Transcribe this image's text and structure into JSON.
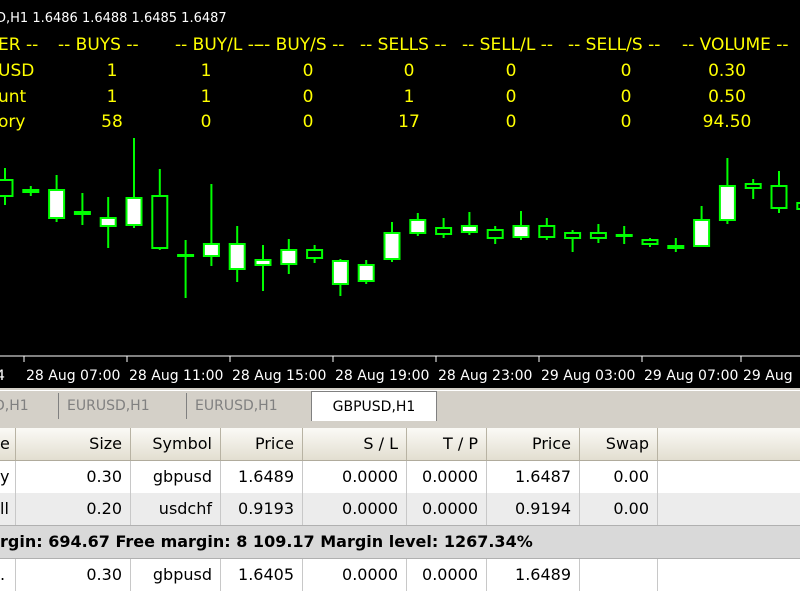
{
  "chart": {
    "info_line": "D,H1  1.6486 1.6488 1.6485 1.6487",
    "panel_headers": [
      "ER --",
      "-- BUYS --",
      "-- BUY/L --",
      "-- BUY/S --",
      "-- SELLS --",
      "-- SELL/L --",
      "-- SELL/S --",
      "-- VOLUME --"
    ],
    "panel_rows": [
      {
        "label": "USD",
        "values": [
          "1",
          "1",
          "0",
          "0",
          "0",
          "0",
          "0.30"
        ]
      },
      {
        "label": "unt",
        "values": [
          "1",
          "1",
          "0",
          "1",
          "0",
          "0",
          "0.50"
        ]
      },
      {
        "label": "ory",
        "values": [
          "58",
          "0",
          "0",
          "17",
          "0",
          "0",
          "94.50"
        ]
      }
    ],
    "time_labels": [
      "4",
      "28 Aug 07:00",
      "28 Aug 11:00",
      "28 Aug 15:00",
      "28 Aug 19:00",
      "28 Aug 23:00",
      "29 Aug 03:00",
      "29 Aug 07:00",
      "29 Aug"
    ],
    "colors": {
      "background": "#000000",
      "up_candle": "#ffffff",
      "wick": "#00ff00",
      "panel_text": "#ffff00"
    }
  },
  "chart_data": {
    "type": "candlestick",
    "note_units": "approximate relative price levels",
    "candles": [
      {
        "o": 180,
        "c": 196,
        "h": 168,
        "l": 205
      },
      {
        "o": 190,
        "c": 192,
        "h": 186,
        "l": 196
      },
      {
        "o": 218,
        "c": 190,
        "h": 175,
        "l": 222
      },
      {
        "o": 212,
        "c": 214,
        "h": 193,
        "l": 225
      },
      {
        "o": 226,
        "c": 218,
        "h": 197,
        "l": 248
      },
      {
        "o": 225,
        "c": 198,
        "h": 138,
        "l": 228
      },
      {
        "o": 196,
        "c": 248,
        "h": 169,
        "l": 250
      },
      {
        "o": 255,
        "c": 255,
        "h": 240,
        "l": 298
      },
      {
        "o": 256,
        "c": 244,
        "h": 184,
        "l": 266
      },
      {
        "o": 269,
        "c": 244,
        "h": 226,
        "l": 282
      },
      {
        "o": 265,
        "c": 260,
        "h": 245,
        "l": 291
      },
      {
        "o": 264,
        "c": 250,
        "h": 239,
        "l": 274
      },
      {
        "o": 250,
        "c": 258,
        "h": 245,
        "l": 263
      },
      {
        "o": 284,
        "c": 261,
        "h": 259,
        "l": 296
      },
      {
        "o": 281,
        "c": 265,
        "h": 260,
        "l": 284
      },
      {
        "o": 259,
        "c": 233,
        "h": 222,
        "l": 262
      },
      {
        "o": 233,
        "c": 220,
        "h": 213,
        "l": 236
      },
      {
        "o": 228,
        "c": 234,
        "h": 218,
        "l": 238
      },
      {
        "o": 232,
        "c": 226,
        "h": 212,
        "l": 235
      },
      {
        "o": 230,
        "c": 238,
        "h": 226,
        "l": 244
      },
      {
        "o": 237,
        "c": 226,
        "h": 211,
        "l": 240
      },
      {
        "o": 226,
        "c": 237,
        "h": 218,
        "l": 240
      },
      {
        "o": 233,
        "c": 238,
        "h": 230,
        "l": 252
      },
      {
        "o": 233,
        "c": 238,
        "h": 224,
        "l": 243
      },
      {
        "o": 235,
        "c": 235,
        "h": 226,
        "l": 244
      },
      {
        "o": 240,
        "c": 244,
        "h": 238,
        "l": 247
      },
      {
        "o": 246,
        "c": 248,
        "h": 238,
        "l": 252
      },
      {
        "o": 246,
        "c": 220,
        "h": 206,
        "l": 247
      },
      {
        "o": 220,
        "c": 186,
        "h": 158,
        "l": 224
      },
      {
        "o": 184,
        "c": 188,
        "h": 179,
        "l": 199
      },
      {
        "o": 186,
        "c": 208,
        "h": 171,
        "l": 213
      },
      {
        "o": 203,
        "c": 209,
        "h": 182,
        "l": 220
      }
    ]
  },
  "tabs": [
    "D,H1",
    "EURUSD,H1",
    "EURUSD,H1",
    "GBPUSD,H1"
  ],
  "table": {
    "headers": [
      "e",
      "Size",
      "Symbol",
      "Price",
      "S / L",
      "T / P",
      "Price",
      "Swap"
    ],
    "rows": [
      [
        "y",
        "0.30",
        "gbpusd",
        "1.6489",
        "0.0000",
        "0.0000",
        "1.6487",
        "0.00"
      ],
      [
        "ll",
        "0.20",
        "usdchf",
        "0.9193",
        "0.0000",
        "0.0000",
        "0.9194",
        "0.00"
      ]
    ],
    "summary": "rgin: 694.67  Free margin: 8 109.17  Margin level: 1267.34%",
    "pending_rows": [
      [
        ".",
        "0.30",
        "gbpusd",
        "1.6405",
        "0.0000",
        "0.0000",
        "1.6489",
        ""
      ]
    ]
  }
}
